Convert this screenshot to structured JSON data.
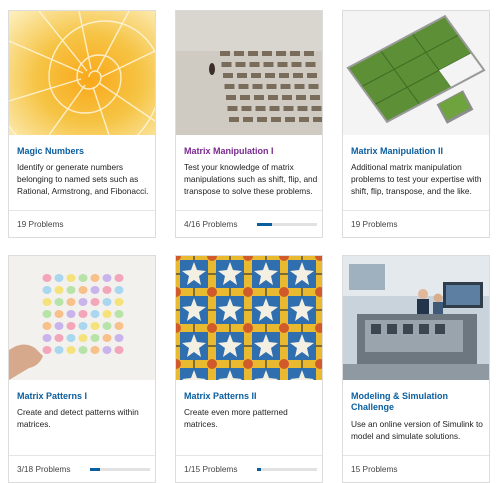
{
  "cards": [
    {
      "title": "Magic Numbers",
      "description": "Identify or generate numbers belonging to named sets such as Rational, Armstrong, and Fibonacci.",
      "problems_text": "19 Problems",
      "image": "nautilus-shell-image"
    },
    {
      "title": "Matrix Manipulation I",
      "description": "Test your knowledge of matrix manipulations such as shift, flip, and transpose to solve these problems.",
      "problems_text": "4/16 Problems",
      "progress": 0.25,
      "image": "bench-grid-image"
    },
    {
      "title": "Matrix Manipulation II",
      "description": "Additional matrix manipulation problems to test your expertise with shift, flip, transpose, and the like.",
      "problems_text": "19 Problems",
      "image": "grass-tiles-image"
    },
    {
      "title": "Matrix Patterns I",
      "description": "Create and detect patterns within matrices.",
      "problems_text": "3/18 Problems",
      "progress": 0.167,
      "image": "candy-grid-image"
    },
    {
      "title": "Matrix Patterns II",
      "description": "Create even more patterned matrices.",
      "problems_text": "1/15 Problems",
      "progress": 0.067,
      "image": "mosaic-tiles-image"
    },
    {
      "title": "Modeling & Simulation Challenge",
      "description": "Use an online version of Simulink to model and simulate solutions.",
      "problems_text": "15 Problems",
      "image": "engine-lab-image"
    }
  ],
  "colors": {
    "link_blue": "#0a5e9e",
    "visited_purple": "#7a2a8f",
    "progress_fill": "#0a5e9e",
    "progress_track": "#e2e2e2"
  }
}
